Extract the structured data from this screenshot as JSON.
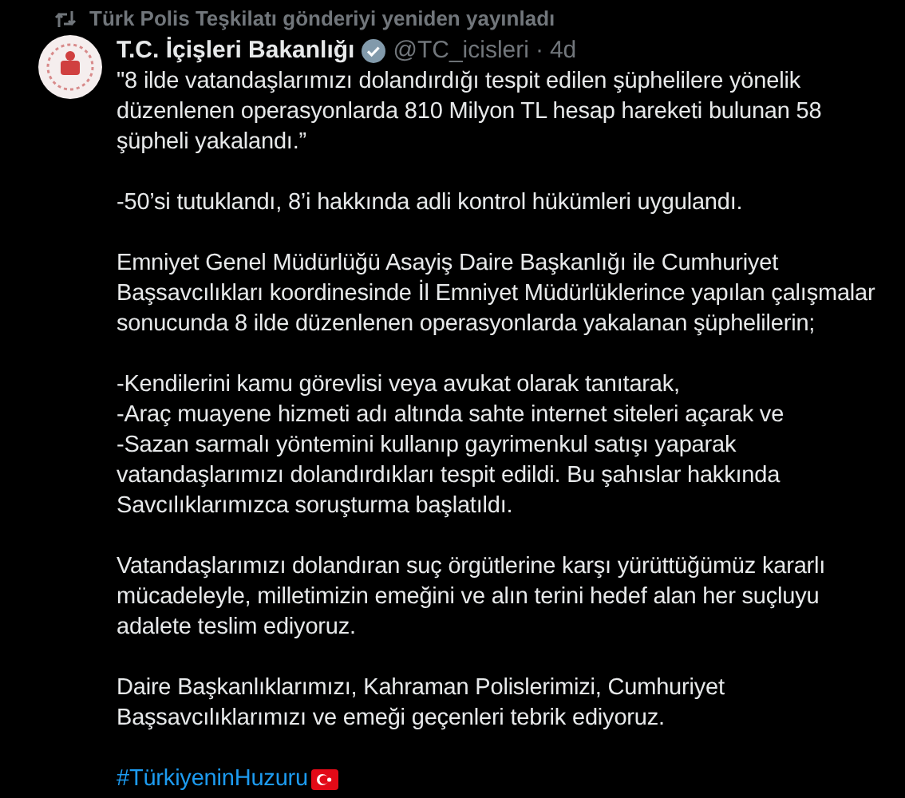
{
  "repost_banner": {
    "text": "Türk Polis Teşkilatı gönderiyi yeniden yayınladı"
  },
  "tweet": {
    "author_name": "T.C. İçişleri Bakanlığı",
    "verified": true,
    "handle": "@TC_icisleri",
    "separator": "·",
    "time": "4d",
    "paragraphs": [
      [
        "\"8 ilde vatandaşlarımızı dolandırdığı tespit edilen şüphelilere yönelik",
        "düzenlenen operasyonlarda 810 Milyon TL hesap hareketi bulunan 58",
        "şüpheli yakalandı.”"
      ],
      [
        "-50’si tutuklandı, 8’i hakkında adli kontrol hükümleri uygulandı."
      ],
      [
        "Emniyet Genel Müdürlüğü Asayiş Daire Başkanlığı ile Cumhuriyet",
        "Başsavcılıkları koordinesinde İl Emniyet Müdürlüklerince yapılan çalışmalar",
        "sonucunda 8 ilde düzenlenen operasyonlarda yakalanan şüphelilerin;"
      ],
      [
        "-Kendilerini kamu görevlisi veya avukat olarak tanıtarak,",
        "-Araç muayene hizmeti adı altında sahte internet siteleri açarak ve",
        "-Sazan sarmalı yöntemini kullanıp gayrimenkul satışı yaparak",
        "vatandaşlarımızı dolandırdıkları tespit edildi. Bu şahıslar hakkında",
        "Savcılıklarımızca soruşturma başlatıldı."
      ],
      [
        "Vatandaşlarımızı dolandıran suç örgütlerine karşı yürüttüğümüz kararlı",
        "mücadeleyle, milletimizin emeğini ve alın terini hedef alan her suçluyu",
        "adalete teslim ediyoruz."
      ],
      [
        "Daire Başkanlıklarımızı, Kahraman Polislerimizi, Cumhuriyet",
        "Başsavcılıklarımızı ve emeği geçenleri tebrik ediyoruz."
      ]
    ],
    "hashtag": "#TürkiyeninHuzuru"
  }
}
